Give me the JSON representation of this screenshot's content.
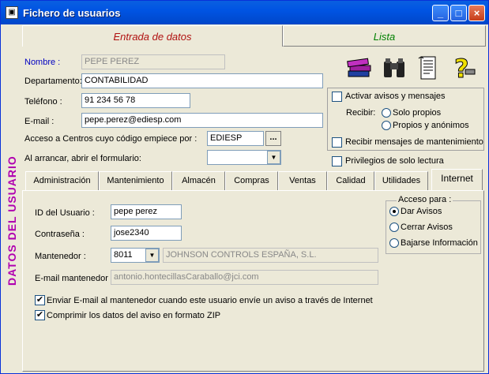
{
  "window": {
    "title": "Fichero de usuarios"
  },
  "sidebar": {
    "title": "DATOS DEL USUARIO"
  },
  "tabs_top": [
    {
      "label": "Entrada de datos"
    },
    {
      "label": "Lista"
    }
  ],
  "form": {
    "nombre_label": "Nombre :",
    "nombre_value": "PEPE PEREZ",
    "departamento_label": "Departamento:",
    "departamento_value": "CONTABILIDAD",
    "telefono_label": "Teléfono :",
    "telefono_value": "91 234 56 78",
    "email_label": "E-mail :",
    "email_value": "pepe.perez@ediesp.com",
    "acceso_label": "Acceso a Centros cuyo código empiece por :",
    "acceso_value": "EDIESP",
    "acceso_button": "...",
    "arrancar_label": "Al arrancar, abrir el formulario:",
    "arrancar_value": ""
  },
  "options": {
    "activar_avisos": "Activar avisos y mensajes",
    "recibir_label": "Recibir:",
    "solo_propios": "Solo propios",
    "propios_anonimos": "Propios y anónimos",
    "mensajes_mantenimiento": "Recibir mensajes de mantenimiento",
    "privilegios": "Privilegios de solo lectura"
  },
  "toolbar_icons": [
    "books-icon",
    "binoculars-icon",
    "document-icon",
    "help-icon"
  ],
  "tabs": [
    {
      "label": "Administración"
    },
    {
      "label": "Mantenimiento"
    },
    {
      "label": "Almacén"
    },
    {
      "label": "Compras"
    },
    {
      "label": "Ventas"
    },
    {
      "label": "Calidad"
    },
    {
      "label": "Utilidades"
    },
    {
      "label": "Internet"
    }
  ],
  "internet": {
    "id_label": "ID del Usuario :",
    "id_value": "pepe perez",
    "password_label": "Contraseña :",
    "password_value": "jose2340",
    "mantenedor_label": "Mantenedor :",
    "mantenedor_code": "8011",
    "mantenedor_name": "JOHNSON CONTROLS ESPAÑA, S.L.",
    "email_mant_label": "E-mail mantenedor :",
    "email_mant_value": "antonio.hontecillasCaraballo@jci.com",
    "enviar_email": "Enviar E-mail al mantenedor cuando este usuario envíe un aviso a través de Internet",
    "comprimir": "Comprimir los datos del aviso en formato ZIP",
    "acceso_title": "Acceso para :",
    "acceso_options": [
      "Dar Avisos",
      "Cerrar Avisos",
      "Bajarse Información"
    ]
  },
  "colors": {
    "title_bar": "#0054e3",
    "sidebar_title": "#b000b0",
    "active_tab": "#b01010",
    "list_tab": "#008000",
    "label_blue": "#0000c0"
  }
}
